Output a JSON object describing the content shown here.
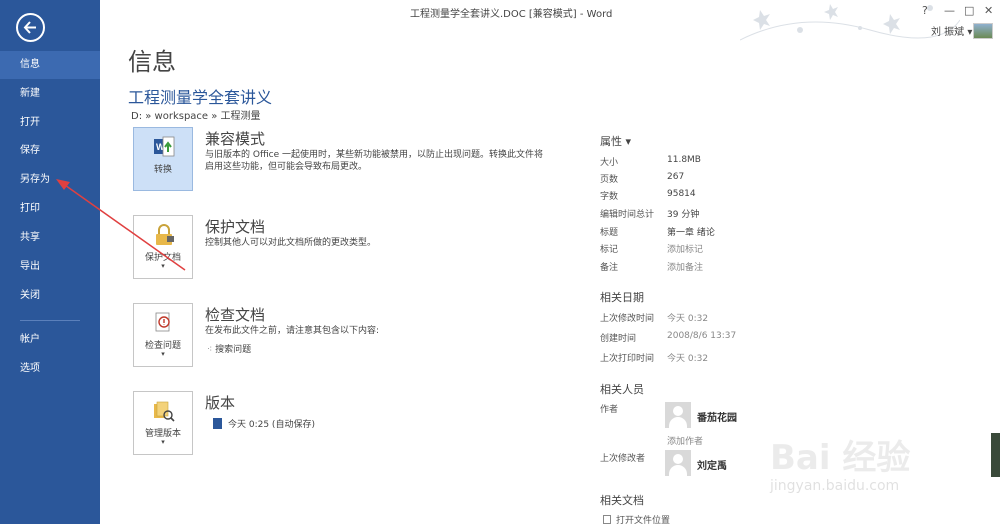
{
  "window": {
    "title": "工程测量学全套讲义.DOC [兼容模式] - Word",
    "help": "?",
    "minimize": "—",
    "restore": "□",
    "close": "✕",
    "user": "刘 振斌 ▾"
  },
  "nav": {
    "items": [
      {
        "label": "信息"
      },
      {
        "label": "新建"
      },
      {
        "label": "打开"
      },
      {
        "label": "保存"
      },
      {
        "label": "另存为"
      },
      {
        "label": "打印"
      },
      {
        "label": "共享"
      },
      {
        "label": "导出"
      },
      {
        "label": "关闭"
      },
      {
        "label": "帐户"
      },
      {
        "label": "选项"
      }
    ]
  },
  "main": {
    "page_title": "信息",
    "doc_title": "工程测量学全套讲义",
    "doc_path": "D: » workspace » 工程测量",
    "compat": {
      "button": "转换",
      "heading": "兼容模式",
      "desc1": "与旧版本的 Office 一起使用时，某些新功能被禁用，以防止出现问题。转换此文件将",
      "desc2": "启用这些功能，但可能会导致布局更改。"
    },
    "protect": {
      "button": "保护文档",
      "heading": "保护文档",
      "desc": "控制其他人可以对此文档所做的更改类型。"
    },
    "inspect": {
      "button": "检查问题",
      "heading": "检查文档",
      "desc": "在发布此文件之前，请注意其包含以下内容:",
      "sub": "搜索问题"
    },
    "versions": {
      "button": "管理版本",
      "heading": "版本",
      "item": "今天 0:25 (自动保存)"
    }
  },
  "props": {
    "heading": "属性 ▾",
    "rows": [
      {
        "label": "大小",
        "value": "11.8MB"
      },
      {
        "label": "页数",
        "value": "267"
      },
      {
        "label": "字数",
        "value": "95814"
      },
      {
        "label": "编辑时间总计",
        "value": "39 分钟"
      },
      {
        "label": "标题",
        "value": "第一章  绪论"
      },
      {
        "label": "标记",
        "value": "添加标记"
      },
      {
        "label": "备注",
        "value": "添加备注"
      }
    ],
    "dates_heading": "相关日期",
    "dates": [
      {
        "label": "上次修改时间",
        "value": "今天 0:32"
      },
      {
        "label": "创建时间",
        "value": "2008/8/6 13:37"
      },
      {
        "label": "上次打印时间",
        "value": "今天 0:32"
      }
    ],
    "people_heading": "相关人员",
    "author_label": "作者",
    "author_name": "番茄花园",
    "add_author": "添加作者",
    "modifier_label": "上次修改者",
    "modifier_name": "刘定禹",
    "docs_heading": "相关文档",
    "open_location": "打开文件位置"
  },
  "watermark": {
    "main": "Bai 经验",
    "sub": "jingyan.baidu.com"
  },
  "colors": {
    "sidebar": "#2b579a",
    "accent": "#2b579a",
    "annotation": "#e04040"
  }
}
